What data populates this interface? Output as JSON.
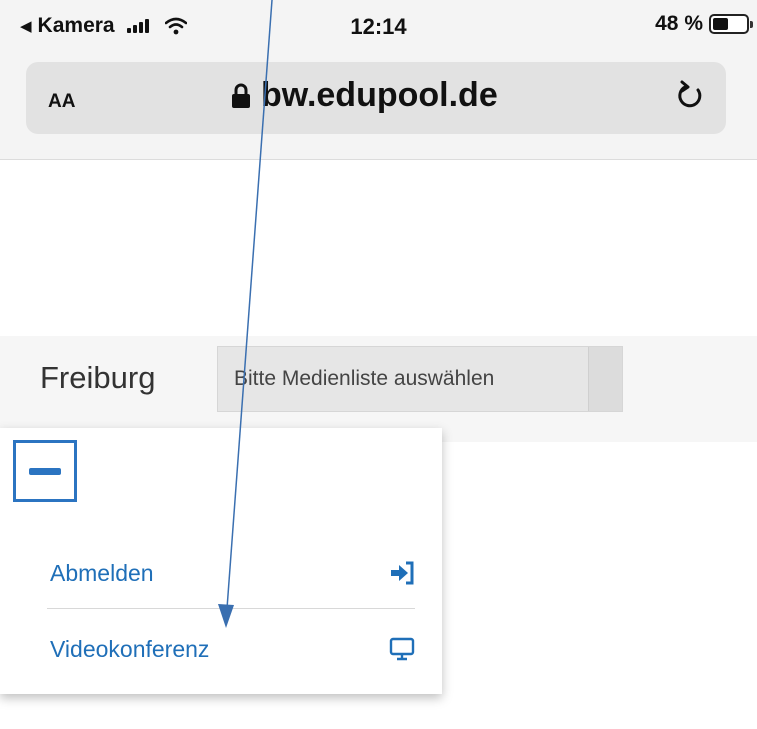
{
  "status_bar": {
    "back_label": "Kamera",
    "time": "12:14",
    "battery_text": "48 %",
    "battery_level": 0.48
  },
  "browser": {
    "text_size_button": "AA",
    "url": "bw.edupool.de"
  },
  "page": {
    "city": "Freiburg",
    "media_list_select": "Bitte Medienliste auswählen"
  },
  "menu": {
    "items": [
      {
        "label": "Abmelden",
        "icon": "sign-in-icon"
      },
      {
        "label": "Videokonferenz",
        "icon": "monitor-icon"
      }
    ]
  },
  "colors": {
    "accent": "#2b74c1",
    "link": "#1f6fb8",
    "annotation_arrow": "#3a6fb0"
  }
}
